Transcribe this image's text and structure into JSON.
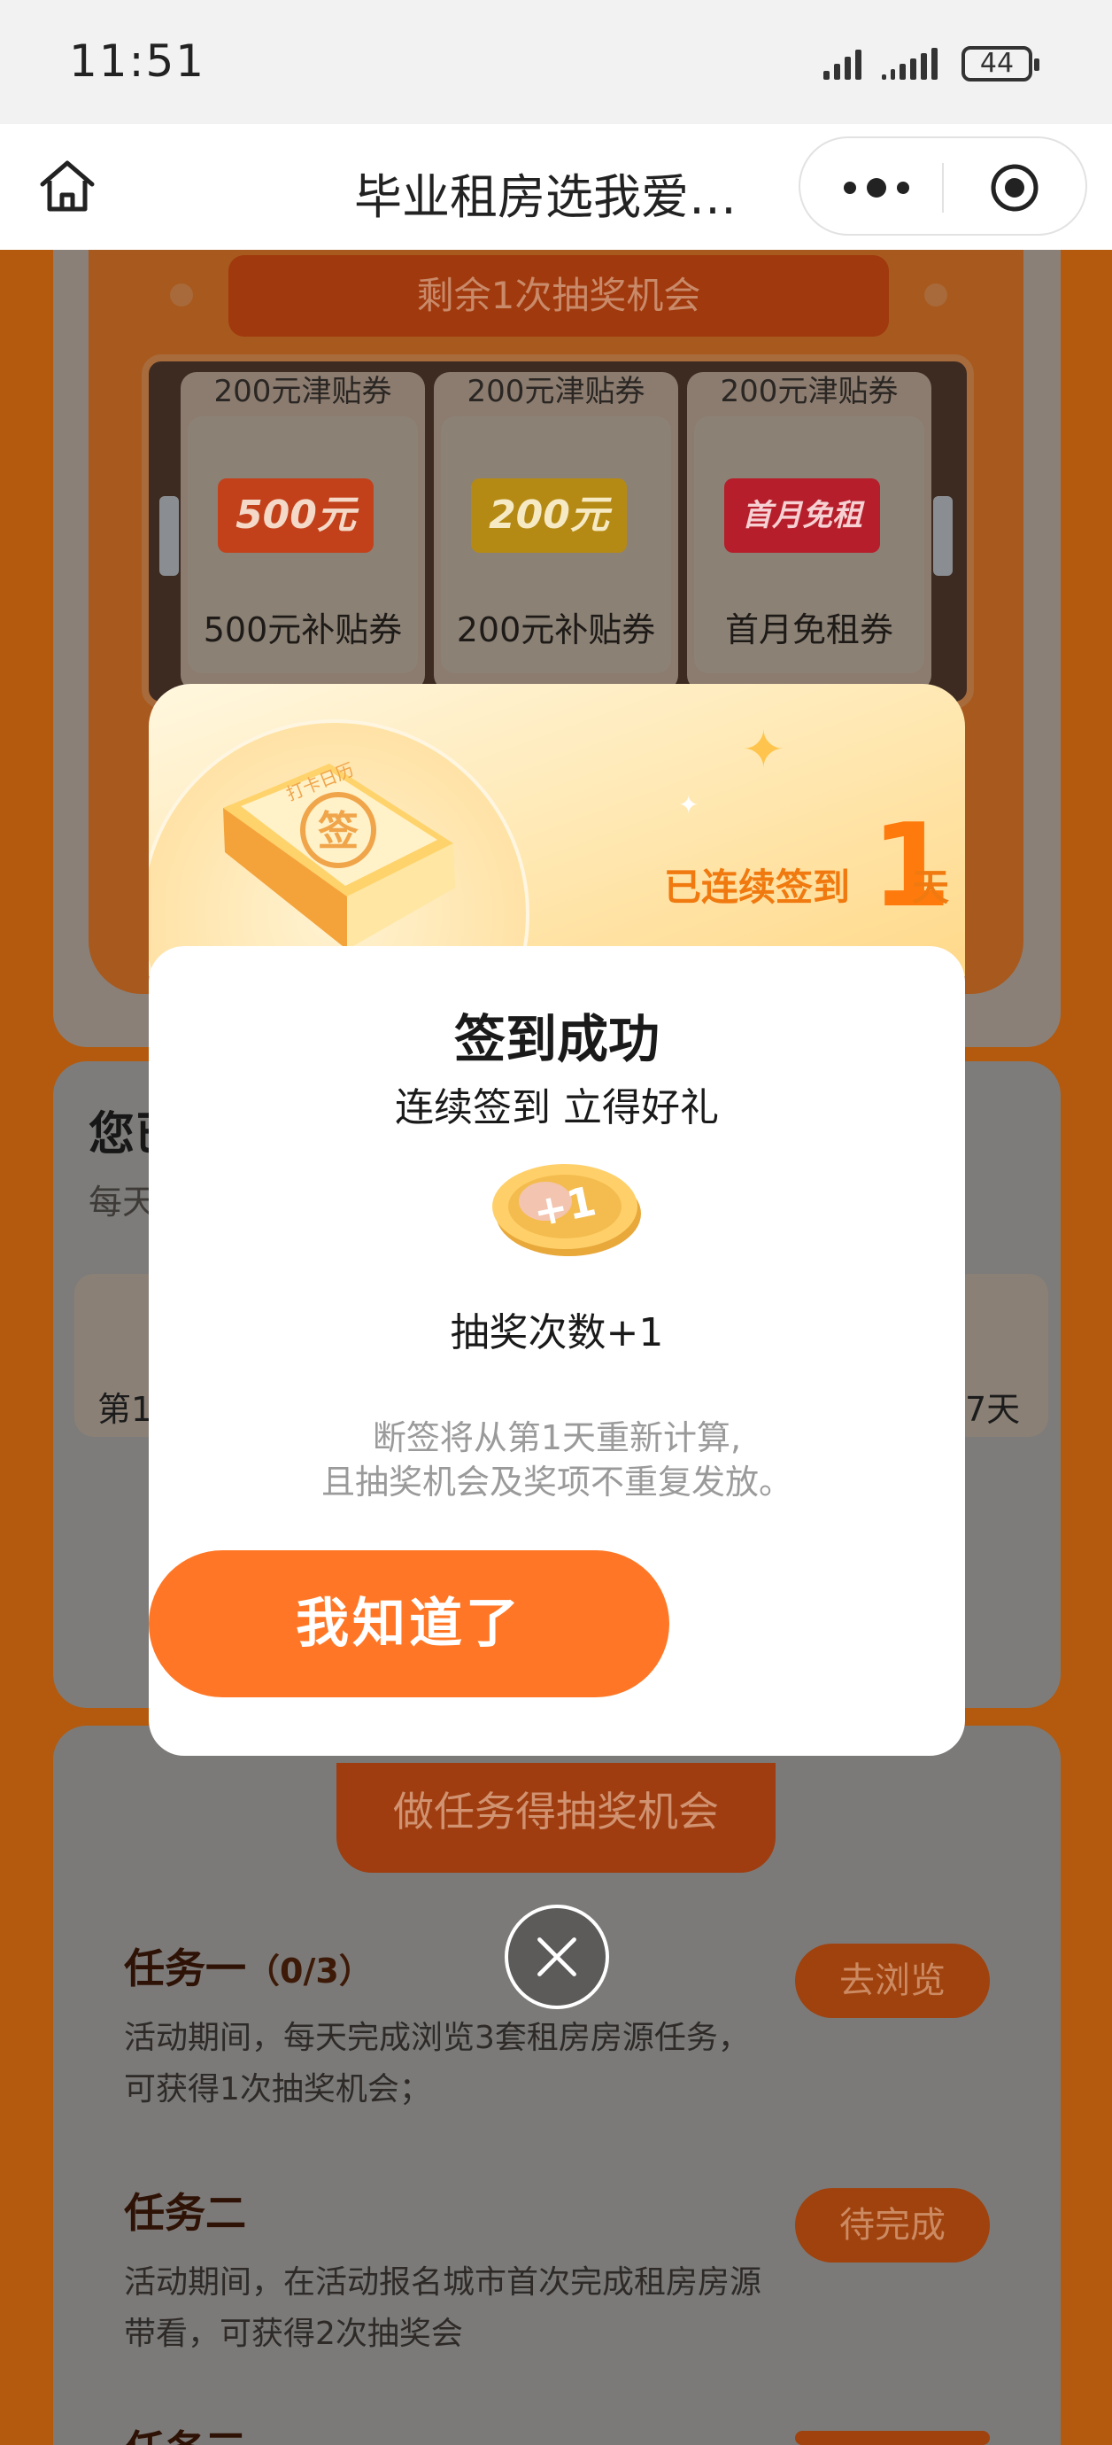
{
  "status_bar": {
    "time": "11:51",
    "battery": "44"
  },
  "title_bar": {
    "title": "毕业租房选我爱…",
    "home_icon": "home-icon",
    "more_icon": "more-dots-icon",
    "target_icon": "target-icon"
  },
  "lottery": {
    "remaining": "剩余1次抽奖机会",
    "reels": [
      {
        "top_label": "200元津贴券",
        "ticket": "500元",
        "label": "500元补贴券",
        "color": "#c2411b"
      },
      {
        "top_label": "200元津贴券",
        "ticket": "200元",
        "label": "200元补贴券",
        "color": "#b58a14"
      },
      {
        "top_label": "200元津贴券",
        "ticket": "首月免租",
        "label": "首月免租券",
        "color": "#b51e2a"
      }
    ]
  },
  "signin": {
    "title": "您已",
    "subtitle": "每天",
    "day_first": "第1",
    "day_last": "7天"
  },
  "tasks": {
    "banner": "做任务得抽奖机会",
    "items": [
      {
        "title": "任务一",
        "progress": "（0/3）",
        "desc": "活动期间，每天完成浏览3套租房房源任务，可获得1次抽奖机会；",
        "button": "去浏览"
      },
      {
        "title": "任务二",
        "progress": "",
        "desc": "活动期间，在活动报名城市首次完成租房房源带看，可获得2次抽奖会",
        "button": "待完成"
      },
      {
        "title": "任务三",
        "progress": "",
        "desc": "",
        "button": ""
      }
    ]
  },
  "modal": {
    "book_text": "打卡日历",
    "streak_prefix": "已连续签到",
    "streak_days": "1",
    "streak_suffix": "天",
    "title": "签到成功",
    "subtitle": "连续签到 立得好礼",
    "coin_text": "+1",
    "reward": "抽奖次数+1",
    "note_line1": "断签将从第1天重新计算,",
    "note_line2": "且抽奖机会及奖项不重复发放。",
    "confirm": "我知道了"
  },
  "colors": {
    "accent": "#ff7726",
    "streak": "#f07a10"
  }
}
